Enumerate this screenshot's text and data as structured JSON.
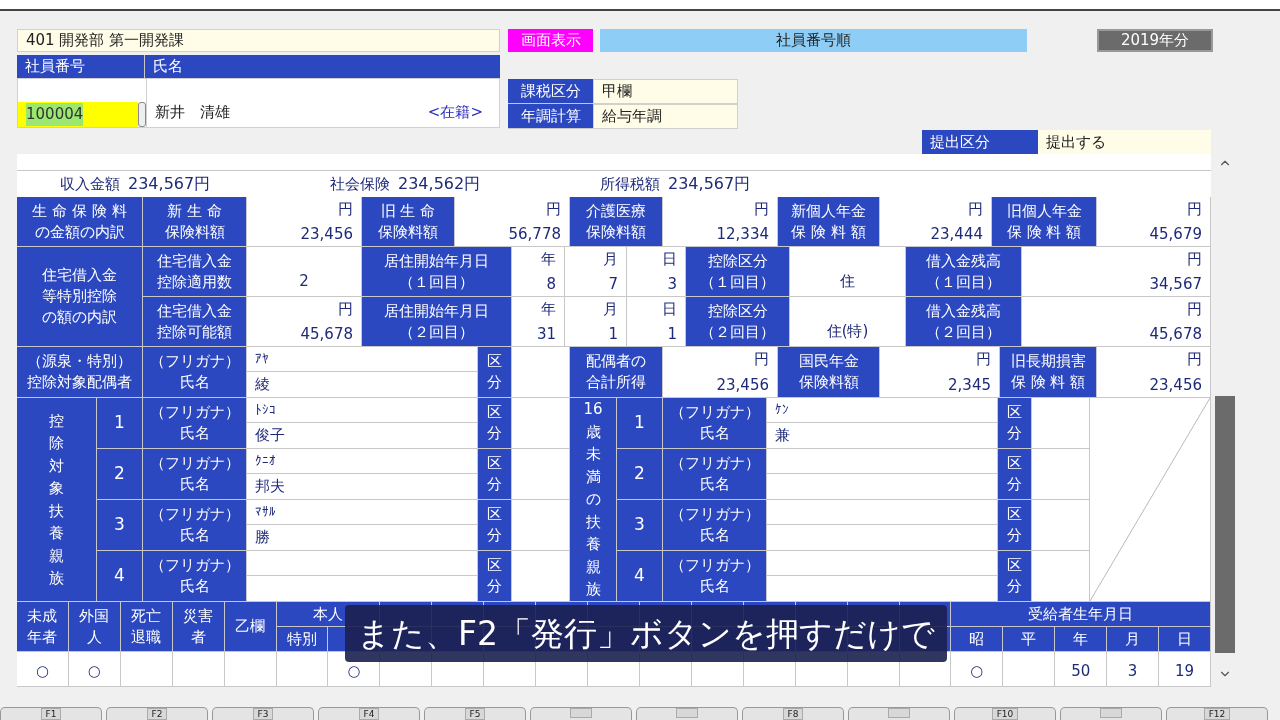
{
  "header": {
    "department": "401 開発部 第一開発課",
    "display_button": "画面表示",
    "sort_order": "社員番号順",
    "year": "2019年分"
  },
  "employee": {
    "number_label": "社員番号",
    "name_label": "氏名",
    "number": "100004",
    "name": "新井　清雄",
    "status": "<在籍>"
  },
  "tax_fields": [
    {
      "label": "課税区分",
      "value": "甲欄"
    },
    {
      "label": "年調計算",
      "value": "給与年調"
    }
  ],
  "submission": {
    "label": "提出区分",
    "value": "提出する"
  },
  "summary": [
    {
      "label": "収入金額",
      "value": "234,567円"
    },
    {
      "label": "社会保険",
      "value": "234,562円"
    },
    {
      "label": "所得税額",
      "value": "234,567円"
    }
  ],
  "life_insurance": {
    "label": [
      "生 命 保 険 料",
      "の金額の内訳"
    ],
    "items": [
      {
        "label": [
          "新 生 命",
          "保険料額"
        ],
        "unit": "円",
        "value": "23,456"
      },
      {
        "label": [
          "旧 生 命",
          "保険料額"
        ],
        "unit": "円",
        "value": "56,778"
      },
      {
        "label": [
          "介護医療",
          "保険料額"
        ],
        "unit": "円",
        "value": "12,334"
      },
      {
        "label": [
          "新個人年金",
          "保 険 料 額"
        ],
        "unit": "円",
        "value": "23,444"
      },
      {
        "label": [
          "旧個人年金",
          "保 険 料 額"
        ],
        "unit": "円",
        "value": "45,679"
      }
    ]
  },
  "housing_loan": {
    "label": [
      "住宅借入金",
      "等特別控除",
      "の額の内訳"
    ],
    "rows": [
      {
        "amount_label": [
          "住宅借入金",
          "控除適用数"
        ],
        "amount": "2",
        "start_label": [
          "居住開始年月日",
          "（１回目）"
        ],
        "year_unit": "年",
        "year": "8",
        "month_unit": "月",
        "month": "7",
        "day_unit": "日",
        "day": "3",
        "category_label": [
          "控除区分",
          "（１回目）"
        ],
        "category": "住",
        "balance_label": [
          "借入金残高",
          "（１回目）"
        ],
        "balance_unit": "円",
        "balance": "34,567"
      },
      {
        "amount_label": [
          "住宅借入金",
          "控除可能額"
        ],
        "amount_unit": "円",
        "amount": "45,678",
        "start_label": [
          "居住開始年月日",
          "（２回目）"
        ],
        "year_unit": "年",
        "year": "31",
        "month_unit": "月",
        "month": "1",
        "day_unit": "日",
        "day": "1",
        "category_label": [
          "控除区分",
          "（２回目）"
        ],
        "category": "住(特)",
        "balance_label": [
          "借入金残高",
          "（２回目）"
        ],
        "balance_unit": "円",
        "balance": "45,678"
      }
    ]
  },
  "spouse": {
    "label": [
      "（源泉・特別）",
      "控除対象配偶者"
    ],
    "name_label": [
      "（フリガナ）",
      "氏名"
    ],
    "furigana": "ｱﾔ",
    "name": "綾",
    "category_label": [
      "区",
      "分"
    ],
    "amounts": [
      {
        "label": [
          "配偶者の",
          "合計所得"
        ],
        "unit": "円",
        "value": "23,456"
      },
      {
        "label": [
          "国民年金",
          "保険料額"
        ],
        "unit": "円",
        "value": "2,345"
      },
      {
        "label": [
          "旧長期損害",
          "保 険 料 額"
        ],
        "unit": "円",
        "value": "23,456"
      }
    ]
  },
  "dependents": {
    "label": "控除対象扶養親族",
    "rows": [
      {
        "number": "1",
        "name_label": [
          "（フリガナ）",
          "氏名"
        ],
        "furigana": "ﾄｼｺ",
        "name": "俊子",
        "category_label": [
          "区",
          "分"
        ]
      },
      {
        "number": "2",
        "name_label": [
          "（フリガナ）",
          "氏名"
        ],
        "furigana": "ｸﾆｵ",
        "name": "邦夫",
        "category_label": [
          "区",
          "分"
        ]
      },
      {
        "number": "3",
        "name_label": [
          "（フリガナ）",
          "氏名"
        ],
        "furigana": "ﾏｻﾙ",
        "name": "勝",
        "category_label": [
          "区",
          "分"
        ]
      },
      {
        "number": "4",
        "name_label": [
          "（フリガナ）",
          "氏名"
        ],
        "category_label": [
          "区",
          "分"
        ]
      }
    ]
  },
  "under16_dependents": {
    "label": "16歳未満の扶養親族",
    "rows": [
      {
        "number": "1",
        "name_label": [
          "（フリガナ）",
          "氏名"
        ],
        "furigana": "ｹﾝ",
        "name": "兼",
        "category_label": [
          "区",
          "分"
        ]
      },
      {
        "number": "2",
        "name_label": [
          "（フリガナ）",
          "氏名"
        ],
        "category_label": [
          "区",
          "分"
        ]
      },
      {
        "number": "3",
        "name_label": [
          "（フリガナ）",
          "氏名"
        ],
        "category_label": [
          "区",
          "分"
        ]
      },
      {
        "number": "4",
        "name_label": [
          "（フリガナ）",
          "氏名"
        ],
        "category_label": [
          "区",
          "分"
        ]
      }
    ]
  },
  "flag_sections": [
    {
      "kind": "single",
      "label": [
        "未成",
        "年者"
      ],
      "value": "○"
    },
    {
      "kind": "single",
      "label": [
        "外国",
        "人"
      ],
      "value": "○"
    },
    {
      "kind": "single",
      "label": [
        "死亡",
        "退職"
      ]
    },
    {
      "kind": "single",
      "label": [
        "災害",
        "者"
      ]
    },
    {
      "kind": "single",
      "label": [
        "乙欄"
      ]
    },
    {
      "kind": "group",
      "label": "本人",
      "columns": [
        {
          "label": "特別"
        },
        {
          "value": "○"
        }
      ]
    },
    {
      "kind": "covered"
    },
    {
      "kind": "group",
      "label": "受給者生年月日",
      "columns": [
        {
          "label": "昭",
          "value": "○"
        },
        {
          "label": "平"
        },
        {
          "label": "年",
          "value": "50"
        },
        {
          "label": "月",
          "value": "3"
        },
        {
          "label": "日",
          "value": "19"
        }
      ]
    }
  ],
  "subtitle": "また、F2「発行」ボタンを押すだけで",
  "function_keys": [
    {
      "kind": "key",
      "label": "F1"
    },
    {
      "kind": "key",
      "label": "F2"
    },
    {
      "kind": "key",
      "label": "F3"
    },
    {
      "kind": "key",
      "label": "F4"
    },
    {
      "kind": "key",
      "label": "F5"
    },
    {
      "kind": "blank"
    },
    {
      "kind": "blank"
    },
    {
      "kind": "key",
      "label": "F8"
    },
    {
      "kind": "blank"
    },
    {
      "kind": "key",
      "label": "F10"
    },
    {
      "kind": "blank"
    },
    {
      "kind": "key",
      "label": "F12"
    }
  ]
}
